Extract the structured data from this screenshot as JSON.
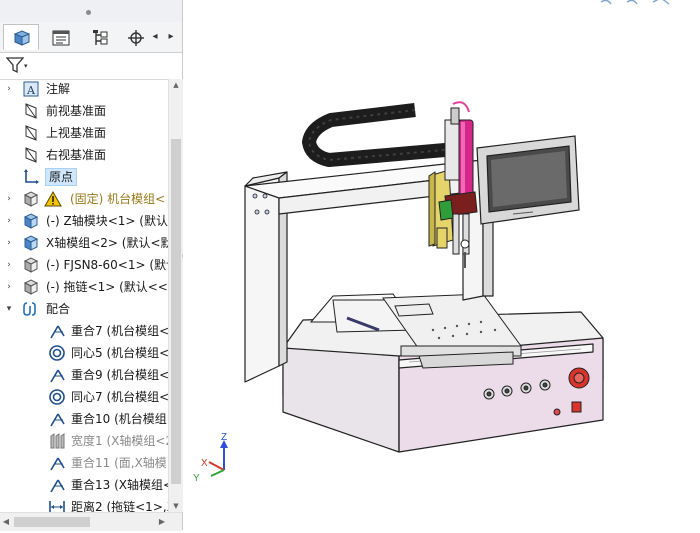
{
  "feature_tree": {
    "items": [
      {
        "label": "注解",
        "icon": "annotation-icon",
        "expandable": true,
        "indent": 0,
        "style": "normal"
      },
      {
        "label": "前视基准面",
        "icon": "plane-icon",
        "expandable": false,
        "indent": 0,
        "style": "normal"
      },
      {
        "label": "上视基准面",
        "icon": "plane-icon",
        "expandable": false,
        "indent": 0,
        "style": "normal"
      },
      {
        "label": "右视基准面",
        "icon": "plane-icon",
        "expandable": false,
        "indent": 0,
        "style": "normal"
      },
      {
        "label": "原点",
        "icon": "origin-icon",
        "expandable": false,
        "indent": 0,
        "style": "normal",
        "selected": true
      },
      {
        "label": "(固定) 机台模组<",
        "icon": "warning-icon",
        "expandable": true,
        "indent": 0,
        "style": "olive"
      },
      {
        "label": "(-) Z轴模块<1> (默认",
        "icon": "assembly-icon",
        "expandable": true,
        "indent": 0,
        "style": "normal"
      },
      {
        "label": "X轴模组<2> (默认<默",
        "icon": "assembly-icon",
        "expandable": true,
        "indent": 0,
        "style": "normal"
      },
      {
        "label": "(-) FJSN8-60<1> (默认",
        "icon": "part-icon",
        "expandable": true,
        "indent": 0,
        "style": "normal"
      },
      {
        "label": "(-) 拖链<1> (默认<<默",
        "icon": "part-icon",
        "expandable": true,
        "indent": 0,
        "style": "normal"
      },
      {
        "label": "配合",
        "icon": "mates-icon",
        "expandable": true,
        "expanded": true,
        "indent": 0,
        "style": "normal"
      },
      {
        "label": "重合7 (机台模组<",
        "icon": "coincident-icon",
        "expandable": false,
        "indent": 1,
        "style": "normal"
      },
      {
        "label": "同心5 (机台模组<",
        "icon": "concentric-icon",
        "expandable": false,
        "indent": 1,
        "style": "normal"
      },
      {
        "label": "重合9 (机台模组<",
        "icon": "coincident-icon",
        "expandable": false,
        "indent": 1,
        "style": "normal"
      },
      {
        "label": "同心7 (机台模组<",
        "icon": "concentric-icon",
        "expandable": false,
        "indent": 1,
        "style": "normal"
      },
      {
        "label": "重合10 (机台模组",
        "icon": "coincident-icon",
        "expandable": false,
        "indent": 1,
        "style": "normal"
      },
      {
        "label": "宽度1 (X轴模组<2",
        "icon": "width-mate-icon",
        "expandable": false,
        "indent": 1,
        "style": "gray"
      },
      {
        "label": "重合11 (面,X轴模",
        "icon": "coincident-icon",
        "expandable": false,
        "indent": 1,
        "style": "gray"
      },
      {
        "label": "重合13 (X轴模组<",
        "icon": "coincident-icon",
        "expandable": false,
        "indent": 1,
        "style": "normal"
      },
      {
        "label": "距离2 (拖链<1>,X",
        "icon": "distance-icon",
        "expandable": false,
        "indent": 1,
        "style": "normal"
      }
    ]
  },
  "panel_tabs": [
    {
      "name": "feature-manager-tab",
      "icon": "feature-manager-icon",
      "active": true
    },
    {
      "name": "property-manager-tab",
      "icon": "property-manager-icon",
      "active": false
    },
    {
      "name": "configuration-manager-tab",
      "icon": "configuration-manager-icon",
      "active": false
    },
    {
      "name": "dimxpert-tab",
      "icon": "dimxpert-icon",
      "active": false
    }
  ],
  "tab_nav": {
    "left": "◂",
    "right": "▸"
  },
  "filter": {
    "icon": "filter-icon",
    "caret": "▾"
  },
  "triad": {
    "z": "Z",
    "x": "X",
    "y": "Y"
  },
  "colors": {
    "selection": "#cfe6fb",
    "olive_text": "#9b7a1a",
    "gray_text": "#8a8a8a",
    "mate_icon": "#1f4f8f"
  }
}
